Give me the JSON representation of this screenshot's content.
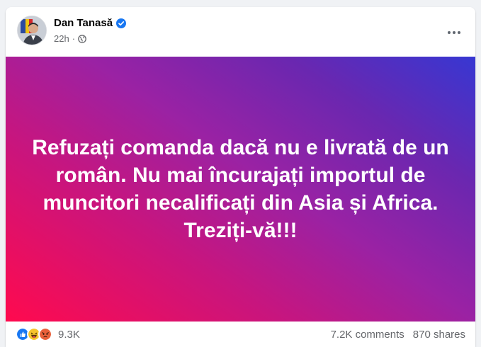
{
  "post": {
    "author": "Dan Tanasă",
    "time": "22h",
    "separator": "·",
    "text": "Refuzați comanda dacă nu e livrată de un român. Nu mai încurajați importul de muncitori necalificați din Asia și Africa. Treziți-vă!!!",
    "background_gradient": [
      "#ff0a4e",
      "#c8157e",
      "#9a22a4",
      "#6a27b0",
      "#3737d2"
    ]
  },
  "icons": {
    "verified": "verified-badge-icon",
    "audience": "globe-icon",
    "more": "more-options-icon",
    "reactions": [
      "like-reaction-icon",
      "haha-reaction-icon",
      "angry-reaction-icon"
    ]
  },
  "engagement": {
    "reactions_count": "9.3K",
    "comments": "7.2K comments",
    "shares": "870 shares"
  },
  "colors": {
    "verified_blue": "#1877f2",
    "secondary_text": "#65676b",
    "primary_text": "#050505"
  }
}
